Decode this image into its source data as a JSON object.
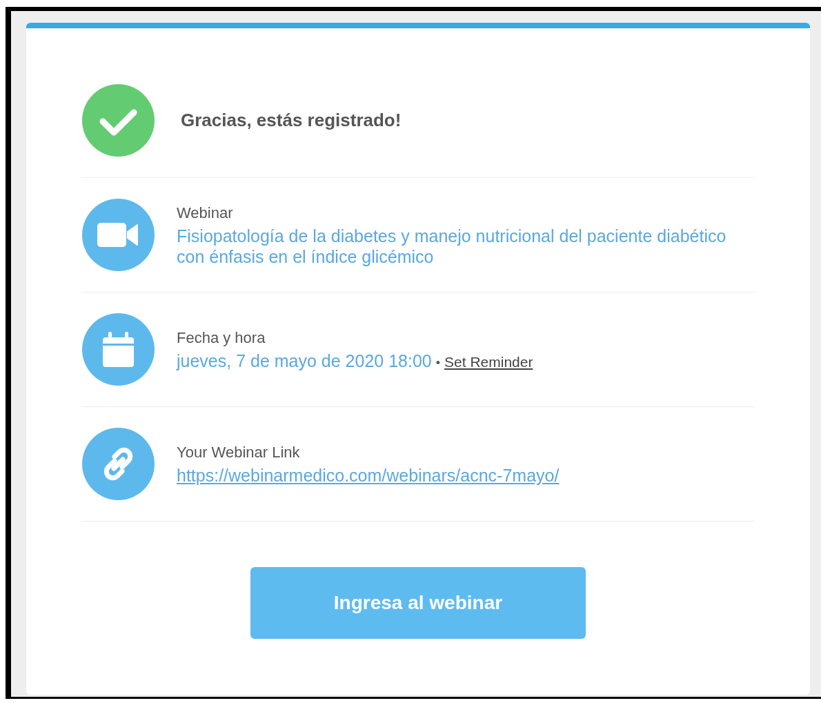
{
  "confirmation": {
    "title": "Gracias, estás registrado!"
  },
  "details": [
    {
      "kind": "webinar",
      "label": "Webinar",
      "value": "Fisiopatología de la diabetes y manejo nutricional del paciente diabético con énfasis en el índice glicémico"
    },
    {
      "kind": "date",
      "label": "Fecha y hora",
      "value": "jueves, 7 de mayo de 2020 18:00",
      "separator": "•",
      "action": "Set Reminder"
    },
    {
      "kind": "link",
      "label": "Your Webinar Link",
      "value": "https://webinarmedico.com/webinars/acnc-7mayo/"
    }
  ],
  "button": {
    "label": "Ingresa al webinar"
  }
}
